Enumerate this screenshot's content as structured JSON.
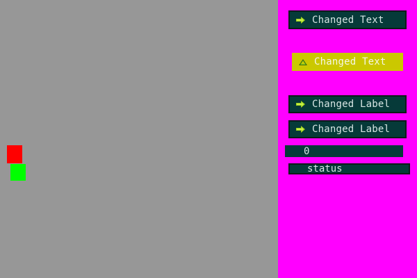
{
  "canvas": {
    "background": "#979797",
    "squares": [
      {
        "name": "red-square",
        "color": "#ff0000"
      },
      {
        "name": "green-square",
        "color": "#00ff00"
      }
    ]
  },
  "panel": {
    "background": "#ff00ff",
    "buttons": [
      {
        "label": "Changed Text",
        "icon": "arrow-right-icon"
      },
      {
        "label": "Changed Text",
        "icon": "recycle-arrow-icon",
        "highlight": "#cbc800"
      },
      {
        "label": "Changed Label",
        "icon": "arrow-right-icon"
      },
      {
        "label": "Changed Label",
        "icon": "arrow-right-icon"
      }
    ],
    "number_field": {
      "value": "0"
    },
    "status_field": {
      "value": "status"
    }
  }
}
